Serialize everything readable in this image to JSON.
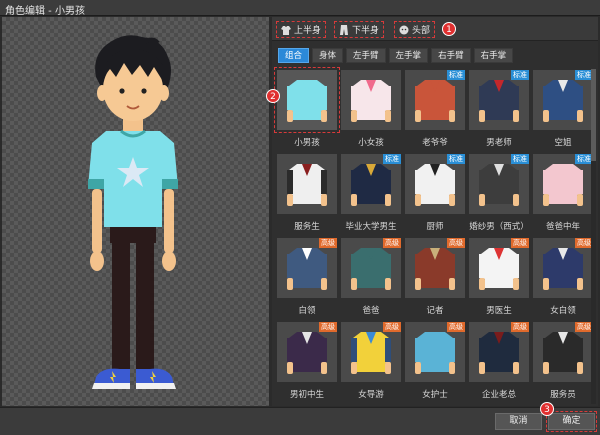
{
  "window": {
    "title": "角色编辑 - 小男孩"
  },
  "tabs": [
    {
      "label": "上半身",
      "icon": "shirt-icon"
    },
    {
      "label": "下半身",
      "icon": "pants-icon"
    },
    {
      "label": "头部",
      "icon": "face-icon"
    }
  ],
  "callouts": [
    "1",
    "2",
    "3"
  ],
  "subtabs": [
    {
      "label": "组合",
      "active": true
    },
    {
      "label": "身体",
      "active": false
    },
    {
      "label": "左手臂",
      "active": false
    },
    {
      "label": "左手掌",
      "active": false
    },
    {
      "label": "右手臂",
      "active": false
    },
    {
      "label": "右手掌",
      "active": false
    }
  ],
  "tags": {
    "std": "标准",
    "adv": "高级"
  },
  "grid": [
    {
      "label": "小男孩",
      "tag": "",
      "shirt": "#7fe0ea",
      "sleeve": "#7fe0ea",
      "selected": true
    },
    {
      "label": "小女孩",
      "tag": "",
      "shirt": "#f7e6ea",
      "sleeve": "#f7e6ea",
      "accent": "#f06a8c"
    },
    {
      "label": "老爷爷",
      "tag": "std",
      "shirt": "#c9553a",
      "sleeve": "#c9553a"
    },
    {
      "label": "男老师",
      "tag": "std",
      "shirt": "#2f3a55",
      "sleeve": "#2f3a55",
      "accent": "#c3272b"
    },
    {
      "label": "空姐",
      "tag": "std",
      "shirt": "#2e4f83",
      "sleeve": "#2e4f83",
      "accent": "#e9e9e9"
    },
    {
      "label": "服务生",
      "tag": "",
      "shirt": "#efefef",
      "sleeve": "#2b2b2b",
      "accent": "#8a1f1f"
    },
    {
      "label": "毕业大学男生",
      "tag": "std",
      "shirt": "#1f2a44",
      "sleeve": "#1f2a44",
      "accent": "#d9a938"
    },
    {
      "label": "厨师",
      "tag": "std",
      "shirt": "#f1f1f1",
      "sleeve": "#f1f1f1",
      "accent": "#222"
    },
    {
      "label": "婚纱男（西式）",
      "tag": "std",
      "shirt": "#3d3d3d",
      "sleeve": "#3d3d3d",
      "accent": "#e0e0e0"
    },
    {
      "label": "爸爸中年",
      "tag": "std",
      "shirt": "#f3c7cf",
      "sleeve": "#f3c7cf"
    },
    {
      "label": "白领",
      "tag": "adv",
      "shirt": "#3f5a80",
      "sleeve": "#3f5a80",
      "accent": "#ffffff"
    },
    {
      "label": "爸爸",
      "tag": "adv",
      "shirt": "#3a6e6e",
      "sleeve": "#3a6e6e"
    },
    {
      "label": "记者",
      "tag": "adv",
      "shirt": "#8a3a2a",
      "sleeve": "#8a3a2a",
      "accent": "#c8b07a"
    },
    {
      "label": "男医生",
      "tag": "adv",
      "shirt": "#f4f4f4",
      "sleeve": "#f4f4f4",
      "accent": "#d33"
    },
    {
      "label": "女白领",
      "tag": "adv",
      "shirt": "#2d3a6a",
      "sleeve": "#2d3a6a",
      "accent": "#e8e8e8"
    },
    {
      "label": "男初中生",
      "tag": "adv",
      "shirt": "#3b2a4a",
      "sleeve": "#3b2a4a",
      "accent": "#e6e6e6"
    },
    {
      "label": "女导游",
      "tag": "adv",
      "shirt": "#f2d13a",
      "sleeve": "#2e4e7a",
      "accent": "#3a8ad6"
    },
    {
      "label": "女护士",
      "tag": "adv",
      "shirt": "#5ab3d6",
      "sleeve": "#5ab3d6"
    },
    {
      "label": "企业老总",
      "tag": "adv",
      "shirt": "#1f2b3e",
      "sleeve": "#1f2b3e",
      "accent": "#7a1c1c"
    },
    {
      "label": "服务员",
      "tag": "adv",
      "shirt": "#2a2a2a",
      "sleeve": "#2a2a2a",
      "accent": "#e8e8e8"
    }
  ],
  "footer": {
    "cancel": "取消",
    "ok": "确定"
  },
  "colors": {
    "accent": "#2b89d8",
    "callout": "#e03030",
    "std_tag": "#2a8fd6",
    "adv_tag": "#e06a2c"
  }
}
